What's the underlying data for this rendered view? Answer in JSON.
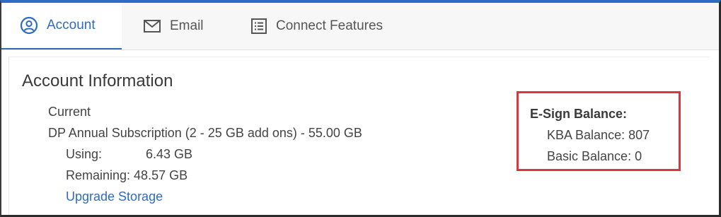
{
  "tabs": [
    {
      "label": "Account",
      "icon": "user-circle-icon",
      "active": true
    },
    {
      "label": "Email",
      "icon": "envelope-icon",
      "active": false
    },
    {
      "label": "Connect Features",
      "icon": "list-icon",
      "active": false
    }
  ],
  "account": {
    "title": "Account Information",
    "current_label": "Current",
    "plan": "DP Annual Subscription (2 - 25 GB add ons) - 55.00 GB",
    "using_label": "Using:",
    "using_value": "6.43 GB",
    "remaining": "Remaining: 48.57 GB",
    "upgrade_link": "Upgrade Storage"
  },
  "esign": {
    "title": "E-Sign Balance:",
    "kba": "KBA Balance: 807",
    "basic": "Basic Balance: 0"
  },
  "colors": {
    "accent": "#2f6bc1",
    "highlight": "#d9363e",
    "text": "#444444"
  }
}
